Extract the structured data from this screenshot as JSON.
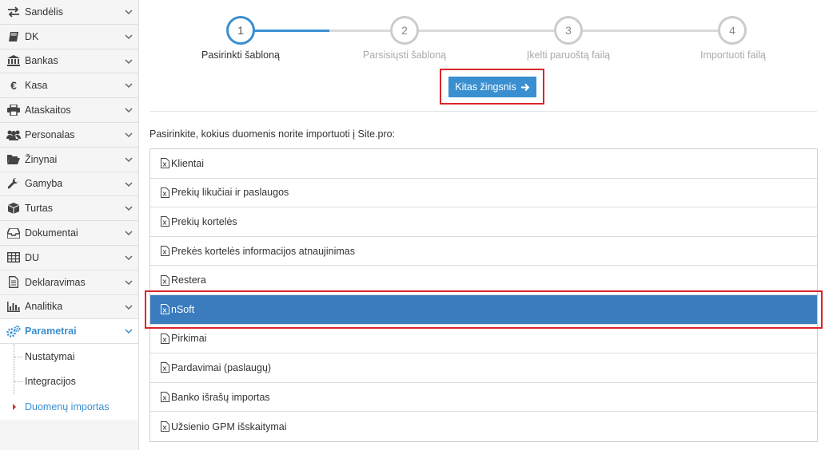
{
  "sidebar": {
    "items": [
      {
        "label": "Sandėlis",
        "icon": "exchange-icon"
      },
      {
        "label": "DK",
        "icon": "book-icon"
      },
      {
        "label": "Bankas",
        "icon": "bank-icon"
      },
      {
        "label": "Kasa",
        "icon": "euro-icon"
      },
      {
        "label": "Ataskaitos",
        "icon": "printer-icon"
      },
      {
        "label": "Personalas",
        "icon": "users-icon"
      },
      {
        "label": "Žinynai",
        "icon": "folder-open-icon"
      },
      {
        "label": "Gamyba",
        "icon": "wrench-icon"
      },
      {
        "label": "Turtas",
        "icon": "cube-icon"
      },
      {
        "label": "Dokumentai",
        "icon": "inbox-icon"
      },
      {
        "label": "DU",
        "icon": "table-icon"
      },
      {
        "label": "Deklaravimas",
        "icon": "file-text-icon"
      },
      {
        "label": "Analitika",
        "icon": "bar-chart-icon"
      },
      {
        "label": "Parametrai",
        "icon": "gears-icon"
      }
    ],
    "sub_items": [
      {
        "label": "Nustatymai"
      },
      {
        "label": "Integracijos"
      },
      {
        "label": "Duomenų importas"
      }
    ]
  },
  "wizard": {
    "steps": [
      {
        "number": "1",
        "label": "Pasirinkti šabloną"
      },
      {
        "number": "2",
        "label": "Parsisiųsti šabloną"
      },
      {
        "number": "3",
        "label": "Įkelti paruoštą failą"
      },
      {
        "number": "4",
        "label": "Importuoti failą"
      }
    ],
    "next_button": "Kitas žingsnis"
  },
  "prompt": "Pasirinkite, kokius duomenis norite importuoti į Site.pro:",
  "import_types": [
    {
      "label": "Klientai"
    },
    {
      "label": "Prekių likučiai ir paslaugos"
    },
    {
      "label": "Prekių kortelės"
    },
    {
      "label": "Prekės kortelės informacijos atnaujinimas"
    },
    {
      "label": "Restera"
    },
    {
      "label": "nSoft"
    },
    {
      "label": "Pirkimai"
    },
    {
      "label": "Pardavimai (paslaugų)"
    },
    {
      "label": "Banko išrašų importas"
    },
    {
      "label": "Užsienio GPM išskaitymai"
    }
  ],
  "colors": {
    "accent": "#3a8fd0",
    "selected": "#3a7cbd",
    "highlight": "#d9262c"
  }
}
